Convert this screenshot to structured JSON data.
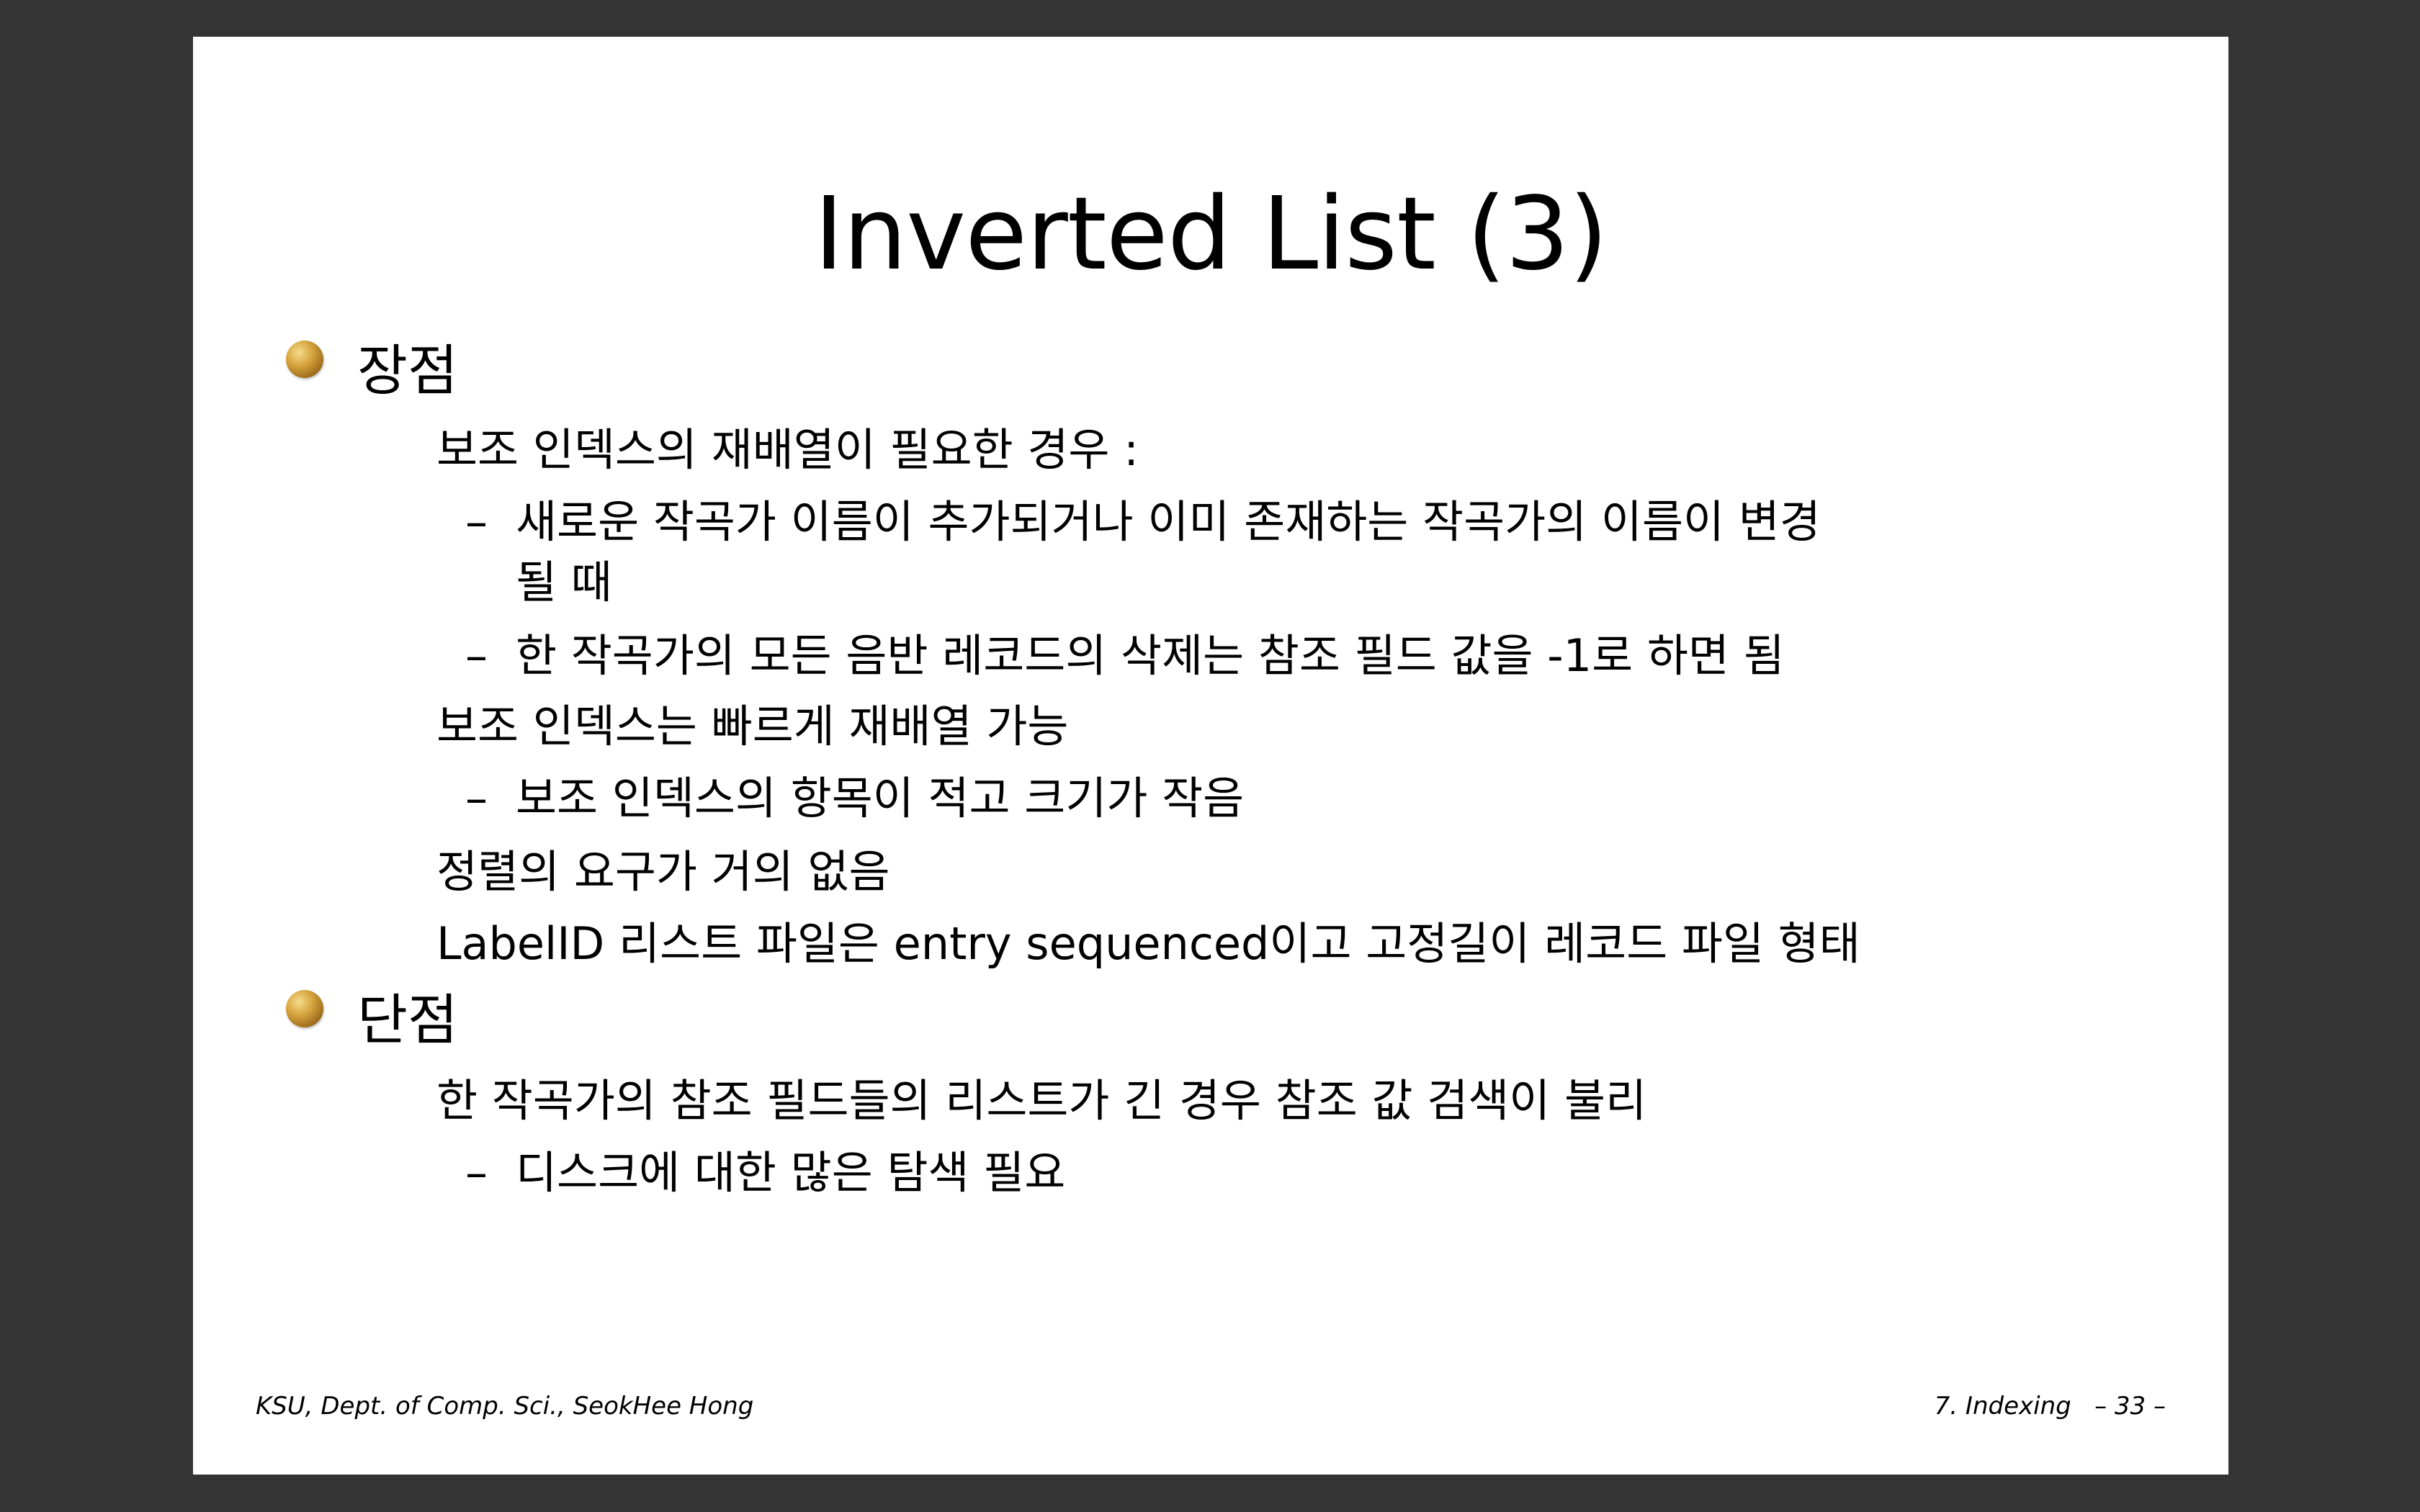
{
  "slide": {
    "title": "Inverted List (3)",
    "advantages_heading": "장점",
    "adv_item1": "보조 인덱스의 재배열이 필요한 경우 :",
    "adv_item1_sub1_line1": "새로운 작곡가 이름이 추가되거나 이미 존재하는 작곡가의 이름이 변경",
    "adv_item1_sub1_line2": "될 때",
    "adv_item1_sub2": "한 작곡가의 모든 음반 레코드의 삭제는 참조 필드 값을 -1로 하면 됨",
    "adv_item2": "보조 인덱스는 빠르게 재배열 가능",
    "adv_item2_sub1": "보조 인덱스의 항목이 적고 크기가 작음",
    "adv_item3": "정렬의 요구가 거의 없음",
    "adv_item4": "LabelID 리스트 파일은 entry sequenced이고 고정길이 레코드 파일 형태",
    "disadvantages_heading": "단점",
    "dis_item1": "한 작곡가의 참조 필드들의 리스트가 긴 경우 참조 값 검색이 불리",
    "dis_item1_sub1": "디스크에 대한 많은 탐색 필요",
    "dash": "–"
  },
  "footer": {
    "left": "KSU, Dept. of Comp. Sci., SeokHee Hong",
    "right": "7. Indexing   – 33 –"
  },
  "colors": {
    "background": "#343434",
    "slide": "#ffffff",
    "text": "#000000",
    "bullet": "#c8923a"
  },
  "icons": {
    "bullet": "gold-ball-bullet-icon"
  }
}
